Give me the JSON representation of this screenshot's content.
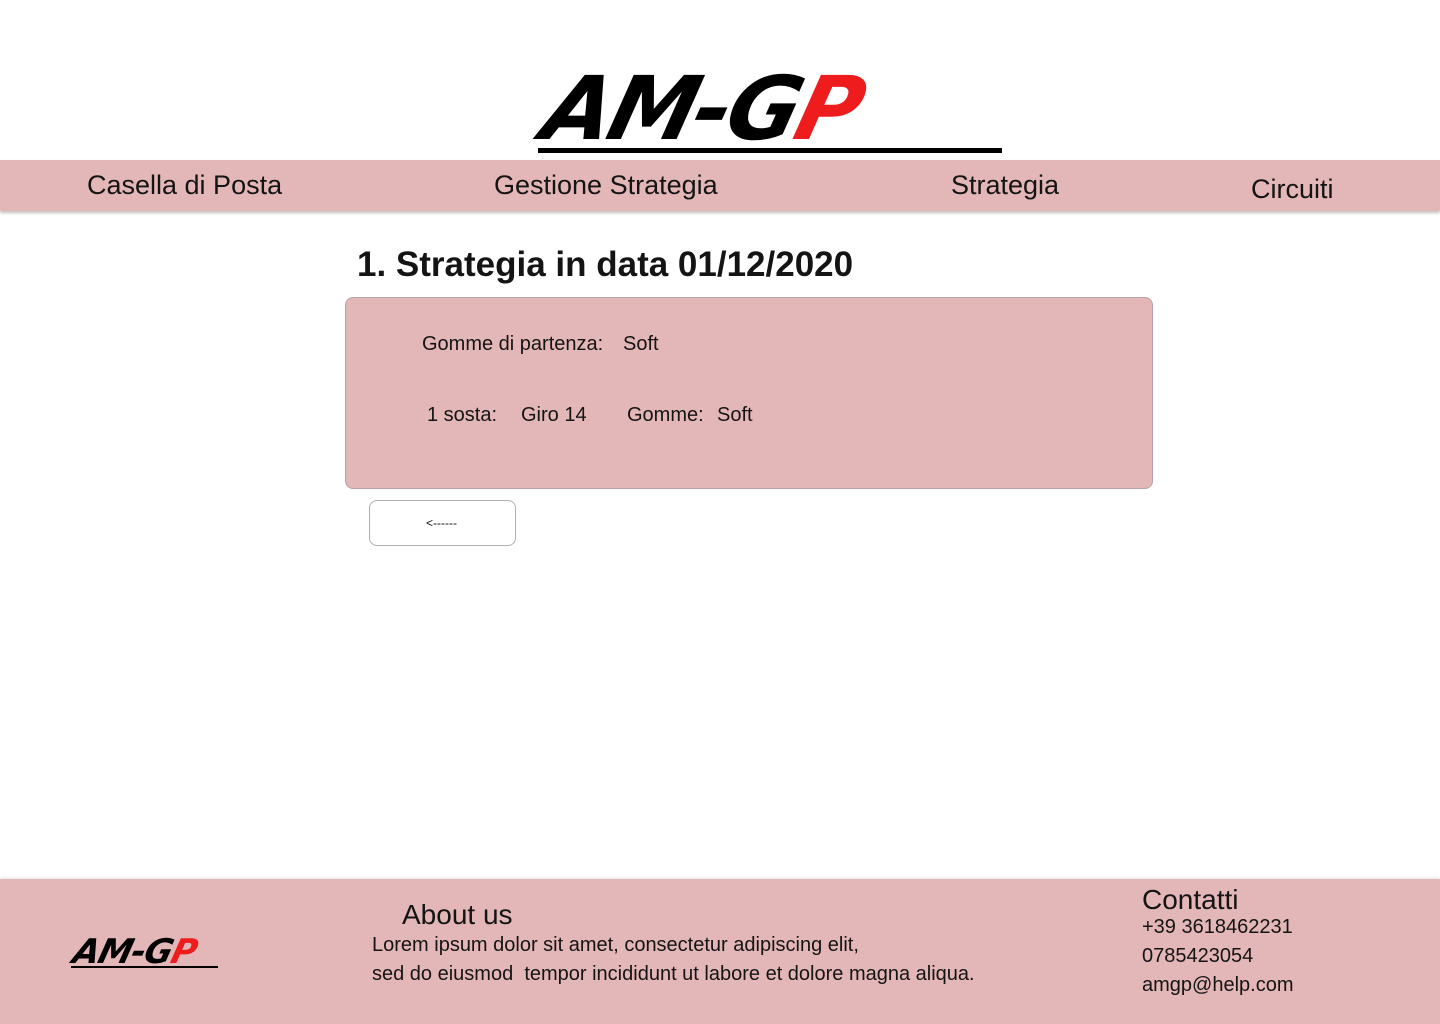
{
  "brand": {
    "logo_part1": "AM-G",
    "logo_part2": "P",
    "logo_black_color": "#000000",
    "logo_red_color": "#ee1c1c"
  },
  "theme": {
    "accent": "#e3b6b7"
  },
  "nav": {
    "items": [
      {
        "label": "Casella di Posta"
      },
      {
        "label": "Gestione Strategia"
      },
      {
        "label": "Strategia"
      },
      {
        "label": "Circuiti"
      }
    ]
  },
  "main": {
    "title": "1. Strategia in data 01/12/2020",
    "strategy": {
      "start_tyres_label": "Gomme di partenza:",
      "start_tyres_value": "Soft",
      "stop_label": "1 sosta:",
      "stop_value": "Giro 14",
      "stop_tyres_label": "Gomme:",
      "stop_tyres_value": "Soft"
    },
    "back_button_label": "<------"
  },
  "footer": {
    "about_title": "About us",
    "about_line1": "Lorem ipsum dolor sit amet, consectetur adipiscing elit,",
    "about_line2": "sed do eiusmod  tempor incididunt ut labore et dolore magna aliqua.",
    "contact_title": "Contatti",
    "phone1": "+39 3618462231",
    "phone2": "0785423054",
    "email": "amgp@help.com"
  }
}
